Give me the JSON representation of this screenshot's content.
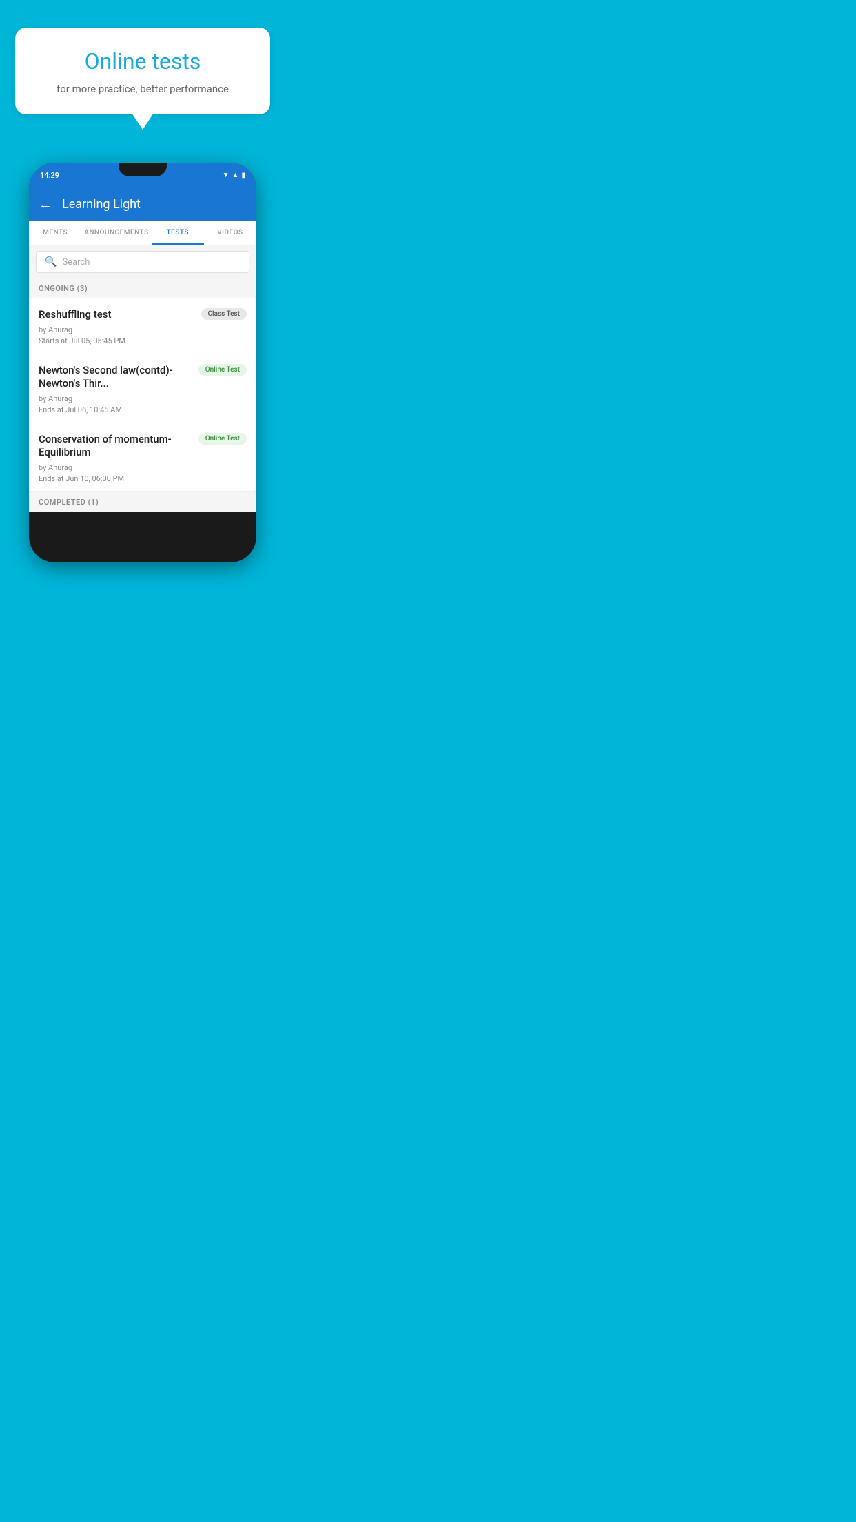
{
  "background_color": "#00B5D8",
  "hero": {
    "bubble_title": "Online tests",
    "bubble_subtitle": "for more practice, better performance"
  },
  "phone": {
    "status_bar": {
      "time": "14:29",
      "icons": [
        "wifi",
        "signal",
        "battery"
      ]
    },
    "app_bar": {
      "title": "Learning Light",
      "back_label": "←"
    },
    "tabs": [
      {
        "label": "MENTS",
        "active": false
      },
      {
        "label": "ANNOUNCEMENTS",
        "active": false
      },
      {
        "label": "TESTS",
        "active": true
      },
      {
        "label": "VIDEOS",
        "active": false
      }
    ],
    "search": {
      "placeholder": "Search"
    },
    "ongoing_section": {
      "label": "ONGOING (3)",
      "tests": [
        {
          "title": "Reshuffling test",
          "badge": "Class Test",
          "badge_type": "class",
          "by": "by Anurag",
          "date_label": "Starts at",
          "date": "Jul 05, 05:45 PM"
        },
        {
          "title": "Newton's Second law(contd)-Newton's Thir...",
          "badge": "Online Test",
          "badge_type": "online",
          "by": "by Anurag",
          "date_label": "Ends at",
          "date": "Jul 06, 10:45 AM"
        },
        {
          "title": "Conservation of momentum-Equilibrium",
          "badge": "Online Test",
          "badge_type": "online",
          "by": "by Anurag",
          "date_label": "Ends at",
          "date": "Jun 10, 06:00 PM"
        }
      ]
    },
    "completed_section": {
      "label": "COMPLETED (1)"
    }
  }
}
